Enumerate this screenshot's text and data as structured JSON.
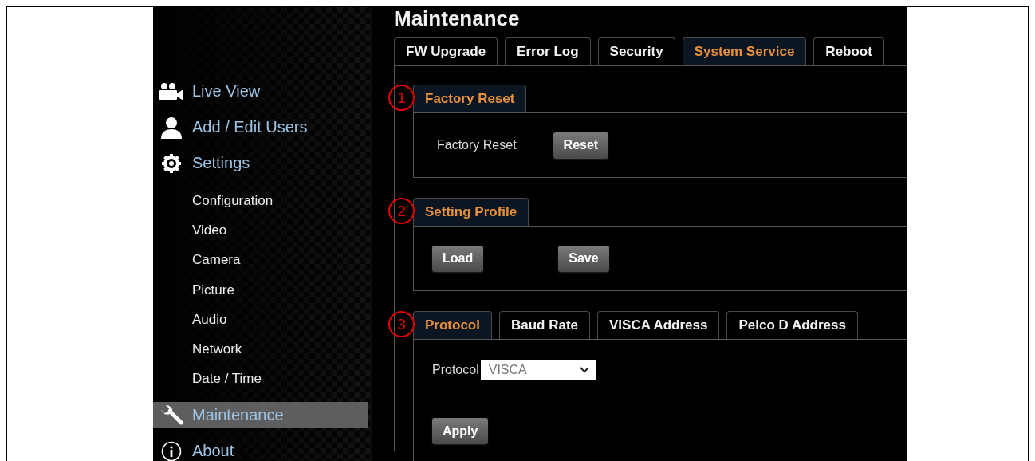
{
  "page_title": "Maintenance",
  "sidebar": {
    "items": [
      {
        "label": "Live View",
        "selected": false
      },
      {
        "label": "Add / Edit Users",
        "selected": false
      },
      {
        "label": "Settings",
        "selected": false,
        "children": [
          {
            "label": "Configuration",
            "selected": false
          },
          {
            "label": "Video",
            "selected": false
          },
          {
            "label": "Camera",
            "selected": false
          },
          {
            "label": "Picture",
            "selected": false
          },
          {
            "label": "Audio",
            "selected": false
          },
          {
            "label": "Network",
            "selected": false
          },
          {
            "label": "Date / Time",
            "selected": false
          }
        ]
      },
      {
        "label": "Maintenance",
        "selected": true
      },
      {
        "label": "About",
        "selected": false
      }
    ]
  },
  "tabs": [
    {
      "label": "FW Upgrade",
      "selected": false
    },
    {
      "label": "Error Log",
      "selected": false
    },
    {
      "label": "Security",
      "selected": false
    },
    {
      "label": "System Service",
      "selected": true
    },
    {
      "label": "Reboot",
      "selected": false
    }
  ],
  "sections": [
    {
      "kind": "action",
      "marker": "1",
      "tabs": [
        {
          "label": "Factory Reset",
          "selected": true
        }
      ],
      "label": "Factory Reset",
      "buttons": [
        "Reset"
      ]
    },
    {
      "kind": "buttons",
      "marker": "2",
      "tabs": [
        {
          "label": "Setting Profile",
          "selected": true
        }
      ],
      "buttons": [
        "Load",
        "Save"
      ]
    },
    {
      "kind": "form",
      "marker": "3",
      "tabs": [
        {
          "label": "Protocol",
          "selected": true
        },
        {
          "label": "Baud Rate",
          "selected": false
        },
        {
          "label": "VISCA Address",
          "selected": false
        },
        {
          "label": "Pelco D Address",
          "selected": false
        }
      ],
      "label": "Protocol",
      "select": {
        "value": "VISCA"
      },
      "buttons": [
        "Apply"
      ]
    }
  ]
}
